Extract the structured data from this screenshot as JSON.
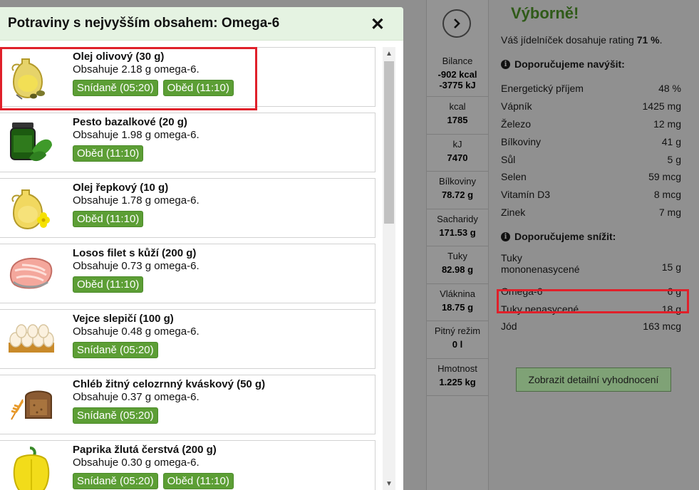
{
  "modal": {
    "title": "Potraviny s nejvyšším obsahem: Omega-6",
    "items": [
      {
        "name": "Olej olivový (30 g)",
        "contains": "Obsahuje 2.18 g omega-6.",
        "tags": [
          "Snídaně (05:20)",
          "Oběd (11:10)"
        ],
        "icon": "olive-oil-icon"
      },
      {
        "name": "Pesto bazalkové (20 g)",
        "contains": "Obsahuje 1.98 g omega-6.",
        "tags": [
          "Oběd (11:10)"
        ],
        "icon": "pesto-jar-icon"
      },
      {
        "name": "Olej řepkový (10 g)",
        "contains": "Obsahuje 1.78 g omega-6.",
        "tags": [
          "Oběd (11:10)"
        ],
        "icon": "rapeseed-oil-icon"
      },
      {
        "name": "Losos filet s kůží (200 g)",
        "contains": "Obsahuje 0.73 g omega-6.",
        "tags": [
          "Oběd (11:10)"
        ],
        "icon": "salmon-icon"
      },
      {
        "name": "Vejce slepičí (100 g)",
        "contains": "Obsahuje 0.48 g omega-6.",
        "tags": [
          "Snídaně (05:20)"
        ],
        "icon": "eggs-icon"
      },
      {
        "name": "Chléb žitný celozrnný kváskový (50 g)",
        "contains": "Obsahuje 0.37 g omega-6.",
        "tags": [
          "Snídaně (05:20)"
        ],
        "icon": "bread-icon"
      },
      {
        "name": "Paprika žlutá čerstvá (200 g)",
        "contains": "Obsahuje 0.30 g omega-6.",
        "tags": [
          "Snídaně (05:20)",
          "Oběd (11:10)"
        ],
        "icon": "yellow-pepper-icon"
      }
    ]
  },
  "stats": [
    {
      "label": "Bilance",
      "value": "-902 kcal",
      "value2": "-3775 kJ"
    },
    {
      "label": "kcal",
      "value": "1785"
    },
    {
      "label": "kJ",
      "value": "7470"
    },
    {
      "label": "Bílkoviny",
      "value": "78.72 g"
    },
    {
      "label": "Sacharidy",
      "value": "171.53 g"
    },
    {
      "label": "Tuky",
      "value": "82.98 g"
    },
    {
      "label": "Vláknina",
      "value": "18.75 g"
    },
    {
      "label": "Pitný režim",
      "value": "0 l"
    },
    {
      "label": "Hmotnost",
      "value": "1.225 kg"
    }
  ],
  "summary": {
    "heading": "Výborně!",
    "rating_prefix": "Váš jídelníček dosahuje rating ",
    "rating_value": "71 %",
    "rating_suffix": ".",
    "increase_title": "Doporučujeme navýšit:",
    "increase": [
      {
        "name": "Energetický příjem",
        "value": "48 %"
      },
      {
        "name": "Vápník",
        "value": "1425 mg"
      },
      {
        "name": "Železo",
        "value": "12 mg"
      },
      {
        "name": "Bílkoviny",
        "value": "41 g"
      },
      {
        "name": "Sůl",
        "value": "5 g"
      },
      {
        "name": "Selen",
        "value": "59 mcg"
      },
      {
        "name": "Vitamín D3",
        "value": "8 mcg"
      },
      {
        "name": "Zinek",
        "value": "7 mg"
      }
    ],
    "decrease_title": "Doporučujeme snížit:",
    "decrease": [
      {
        "name": "Tuky mononenasycené",
        "value": "15 g"
      },
      {
        "name": "Omega-6",
        "value": "6 g"
      },
      {
        "name": "Tuky nenasycené",
        "value": "18 g"
      },
      {
        "name": "Jód",
        "value": "163 mcg"
      }
    ],
    "detail_button": "Zobrazit detailní vyhodnocení"
  },
  "colors": {
    "tag_green": "#5c9e35",
    "header_green": "#e5f3e2",
    "highlight_red": "#e0202a",
    "heading_green": "#2f5a18"
  }
}
